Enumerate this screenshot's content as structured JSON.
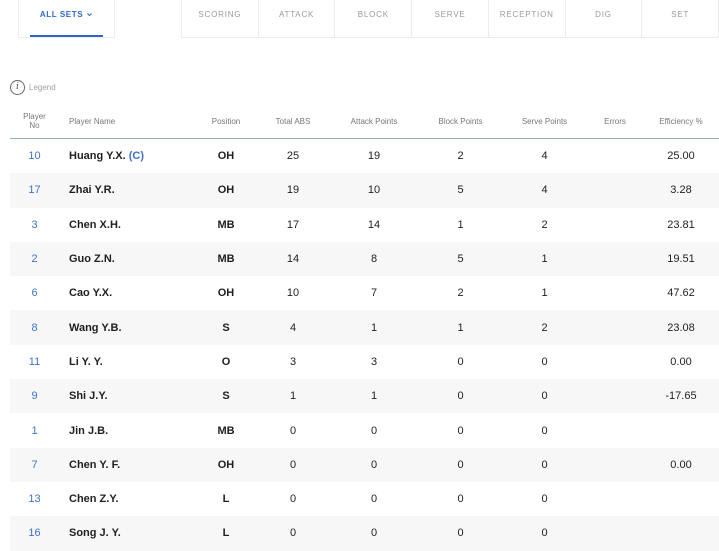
{
  "tabs": {
    "sets_label": "ALL SETS",
    "items": [
      "SCORING",
      "ATTACK",
      "BLOCK",
      "SERVE",
      "RECEPTION",
      "DIG",
      "SET"
    ]
  },
  "legend": {
    "label": "Legend"
  },
  "table": {
    "headers": {
      "player_no_line1": "Player",
      "player_no_line2": "No",
      "player_name": "Player Name",
      "position": "Position",
      "total_abs": "Total ABS",
      "attack_points": "Attack Points",
      "block_points": "Block Points",
      "serve_points": "Serve Points",
      "errors": "Errors",
      "efficiency": "Efficiency %"
    },
    "rows": [
      {
        "no": "10",
        "name": "Huang Y.X.",
        "captain": "(C)",
        "pos": "OH",
        "abs": "25",
        "atk": "19",
        "blk": "2",
        "srv": "4",
        "err": "",
        "eff": "25.00"
      },
      {
        "no": "17",
        "name": "Zhai Y.R.",
        "captain": "",
        "pos": "OH",
        "abs": "19",
        "atk": "10",
        "blk": "5",
        "srv": "4",
        "err": "",
        "eff": "3.28"
      },
      {
        "no": "3",
        "name": "Chen X.H.",
        "captain": "",
        "pos": "MB",
        "abs": "17",
        "atk": "14",
        "blk": "1",
        "srv": "2",
        "err": "",
        "eff": "23.81"
      },
      {
        "no": "2",
        "name": "Guo Z.N.",
        "captain": "",
        "pos": "MB",
        "abs": "14",
        "atk": "8",
        "blk": "5",
        "srv": "1",
        "err": "",
        "eff": "19.51"
      },
      {
        "no": "6",
        "name": "Cao Y.X.",
        "captain": "",
        "pos": "OH",
        "abs": "10",
        "atk": "7",
        "blk": "2",
        "srv": "1",
        "err": "",
        "eff": "47.62"
      },
      {
        "no": "8",
        "name": "Wang Y.B.",
        "captain": "",
        "pos": "S",
        "abs": "4",
        "atk": "1",
        "blk": "1",
        "srv": "2",
        "err": "",
        "eff": "23.08"
      },
      {
        "no": "11",
        "name": "Li Y. Y.",
        "captain": "",
        "pos": "O",
        "abs": "3",
        "atk": "3",
        "blk": "0",
        "srv": "0",
        "err": "",
        "eff": "0.00"
      },
      {
        "no": "9",
        "name": "Shi J.Y.",
        "captain": "",
        "pos": "S",
        "abs": "1",
        "atk": "1",
        "blk": "0",
        "srv": "0",
        "err": "",
        "eff": "-17.65"
      },
      {
        "no": "1",
        "name": "Jin J.B.",
        "captain": "",
        "pos": "MB",
        "abs": "0",
        "atk": "0",
        "blk": "0",
        "srv": "0",
        "err": "",
        "eff": ""
      },
      {
        "no": "7",
        "name": "Chen Y. F.",
        "captain": "",
        "pos": "OH",
        "abs": "0",
        "atk": "0",
        "blk": "0",
        "srv": "0",
        "err": "",
        "eff": "0.00"
      },
      {
        "no": "13",
        "name": "Chen Z.Y.",
        "captain": "",
        "pos": "L",
        "abs": "0",
        "atk": "0",
        "blk": "0",
        "srv": "0",
        "err": "",
        "eff": ""
      },
      {
        "no": "16",
        "name": "Song J. Y.",
        "captain": "",
        "pos": "L",
        "abs": "0",
        "atk": "0",
        "blk": "0",
        "srv": "0",
        "err": "",
        "eff": ""
      }
    ]
  },
  "colors": {
    "accent": "#2f68c9",
    "row_alt": "#f7f7f8",
    "header_rule": "#8cb2b8"
  },
  "icons": {
    "legend": "info-icon",
    "sets_dropdown": "chevron-down-icon"
  }
}
